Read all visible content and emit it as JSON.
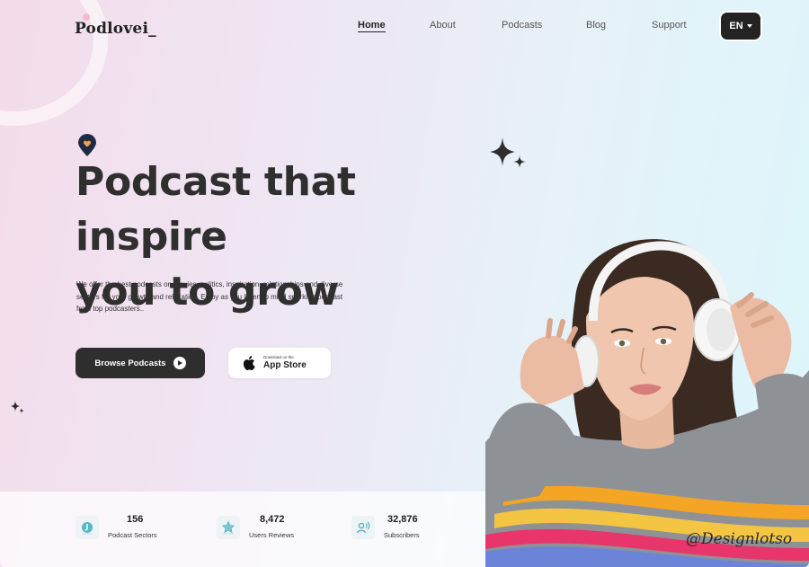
{
  "brand": {
    "logo": "Podlovei_"
  },
  "nav": {
    "items": [
      {
        "label": "Home",
        "active": true
      },
      {
        "label": "About"
      },
      {
        "label": "Podcasts"
      },
      {
        "label": "Blog"
      },
      {
        "label": "Support"
      }
    ],
    "language": "EN"
  },
  "hero": {
    "title_line1": "Podcast that inspire",
    "title_line2": "you to grow",
    "description": "We offer the best podcasts on movies, politics, inspiration, relationships and diverse sectors for your growth and relaxation. Enjoy as you listen to mind sparking podcast from top podcasters..",
    "browse_button": "Browse Podcasts",
    "store_small": "Download on the",
    "store_big": "App Store"
  },
  "stats": [
    {
      "value": "156",
      "label": "Podcast Sectors",
      "icon": "sector-icon"
    },
    {
      "value": "8,472",
      "label": "Users Reviews",
      "icon": "star-icon"
    },
    {
      "value": "32,876",
      "label": "Subscribers",
      "icon": "subscribers-icon"
    }
  ],
  "watermark": "@Designlotso",
  "colors": {
    "dark": "#2e2e2e",
    "accent_pin": "#1f2a44",
    "heart": "#f2a154"
  }
}
